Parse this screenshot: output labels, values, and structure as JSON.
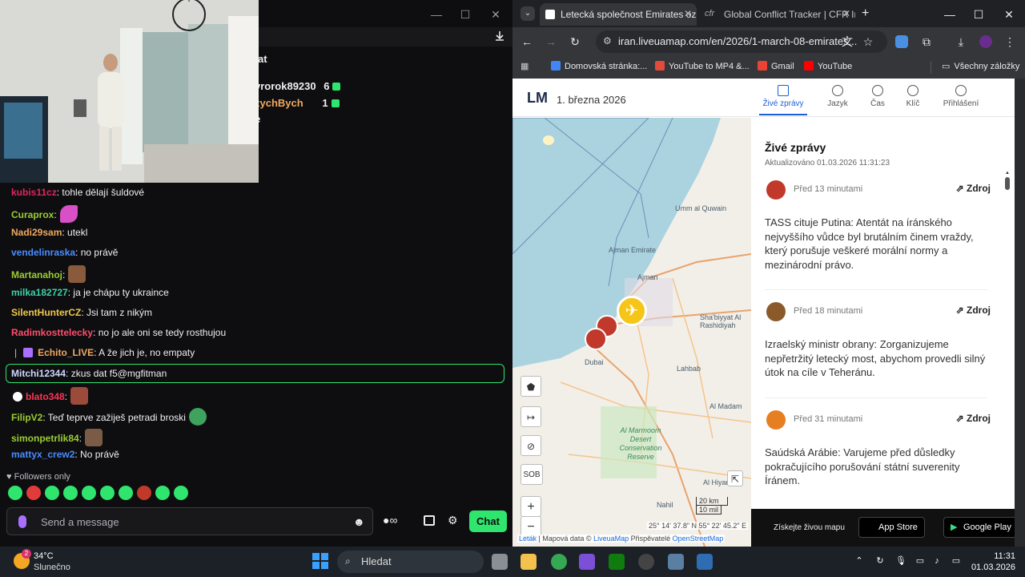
{
  "chat": {
    "header_title": "at",
    "gifters": [
      {
        "name": "vrorok89230",
        "count": "6"
      },
      {
        "name": "zychBych",
        "count": "1"
      }
    ],
    "gifter_extra": "e",
    "messages": [
      {
        "user": "kubis11cz",
        "color": "#e0245e",
        "text": ": tohle dělají šuldové"
      },
      {
        "user": "Curaprox",
        "color": "#9acd32",
        "text": ":",
        "emote": "#d94fc6"
      },
      {
        "user": "Nadi29sam",
        "color": "#f0a860",
        "text": ": utekl"
      },
      {
        "user": "vendelinraska",
        "color": "#4a8cff",
        "text": ": no právě"
      },
      {
        "user": "Martanahoj",
        "color": "#9acd32",
        "text": ":",
        "emote": "#8a5a3c"
      },
      {
        "user": "milka182727",
        "color": "#3fd1a4",
        "text": ": ja je chápu ty ukraince"
      },
      {
        "user": "SilentHunterCZ",
        "color": "#f2c94c",
        "text": ": Jsi tam z nikým"
      },
      {
        "user": "Radimkosttelecky",
        "color": "#ff4d6d",
        "text": ": no jo ale oni se tedy rosthujou"
      },
      {
        "user": "Echito_LIVE",
        "color": "#f0a860",
        "text": ": A že jich je, no empaty"
      },
      {
        "user": "Mitchi12344",
        "color": "#cfd8ff",
        "text": ": zkus dat f5@mgfitman"
      },
      {
        "user": "blato348",
        "color": "#ff3355",
        "text": ":",
        "emote": "#9c4a3a"
      },
      {
        "user": "FilipV2",
        "color": "#9acd32",
        "text": ": Teď teprve zažiješ petradi broski",
        "emote": "#3da35d"
      },
      {
        "user": "simonpetrlik84",
        "color": "#9acd32",
        "text": ":",
        "emote": "#7a5b45"
      },
      {
        "user": "mattyx_crew2",
        "color": "#4a8cff",
        "text": ": No právě"
      }
    ],
    "followers_only": "Followers only",
    "send_placeholder": "Send a message",
    "chat_button": "Chat"
  },
  "browser": {
    "tabs": [
      {
        "title": "Letecká společnost Emirates oz",
        "active": true
      },
      {
        "title": "Global Conflict Tracker | CFR Int",
        "active": false
      }
    ],
    "url": "iran.liveuamap.com/en/2026/1-march-08-emirates...",
    "bookmarks": [
      {
        "label": "Domovská stránka:...",
        "color": "#4285f4"
      },
      {
        "label": "YouTube to MP4 &...",
        "color": "#e04b3a"
      },
      {
        "label": "Gmail",
        "color": "#ea4335"
      },
      {
        "label": "YouTube",
        "color": "#ff0000"
      }
    ],
    "all_bookmarks": "Všechny záložky"
  },
  "site": {
    "logo": "LM",
    "date": "1. března 2026",
    "nav": [
      {
        "label": "Živé zprávy",
        "active": true
      },
      {
        "label": "Jazyk",
        "active": false
      },
      {
        "label": "Čas",
        "active": false
      },
      {
        "label": "Klíč",
        "active": false
      },
      {
        "label": "Přihlášení",
        "active": false
      }
    ],
    "map": {
      "labels": [
        "Umm al Quwain",
        "Ajman Emirate",
        "Ajman",
        "Dubai",
        "Sha'biyyat Al Rashidiyah",
        "Lahbab",
        "Al Madam",
        "Al Marmoom Desert Conservation Reserve",
        "Al Hiyar",
        "Nahil"
      ],
      "controls": [
        "SOB"
      ],
      "scale_km": "20 km",
      "scale_mi": "10 mil",
      "coords": "25° 14' 37.8\" N 55° 22' 45.2\" E",
      "attrib_leaflet": "Leták",
      "attrib_mid": "| Mapová data ©",
      "attrib_lm": "LiveuaMap",
      "attrib_contrib": "Přispěvatelé",
      "attrib_osm": "OpenStreetMap"
    },
    "news": {
      "title": "Živé zprávy",
      "updated": "Aktualizováno 01.03.2026 11:31:23",
      "source_label": "Zdroj",
      "items": [
        {
          "time": "Před 13 minutami",
          "color": "#c0392b",
          "text": "TASS cituje Putina: Atentát na íránského nejvyššího vůdce byl brutálním činem vraždy, který porušuje veškeré morální normy a mezinárodní právo."
        },
        {
          "time": "Před 18 minutami",
          "color": "#8a5a2a",
          "text": "Izraelský ministr obrany: Zorganizujeme nepřetržitý letecký most, abychom provedli silný útok na cíle v Teheránu."
        },
        {
          "time": "Před 31 minutami",
          "color": "#e67e22",
          "text": "Saúdská Arábie: Varujeme před důsledky pokračujícího porušování státní suverenity Íránem."
        }
      ]
    },
    "appbar": {
      "text": "Získejte živou mapu",
      "app_store": "App Store",
      "google_play": "Google Play"
    }
  },
  "taskbar": {
    "temp": "34°C",
    "weather": "Slunečno",
    "badge": "2",
    "search": "Hledat",
    "time": "11:31",
    "date": "01.03.2026"
  }
}
